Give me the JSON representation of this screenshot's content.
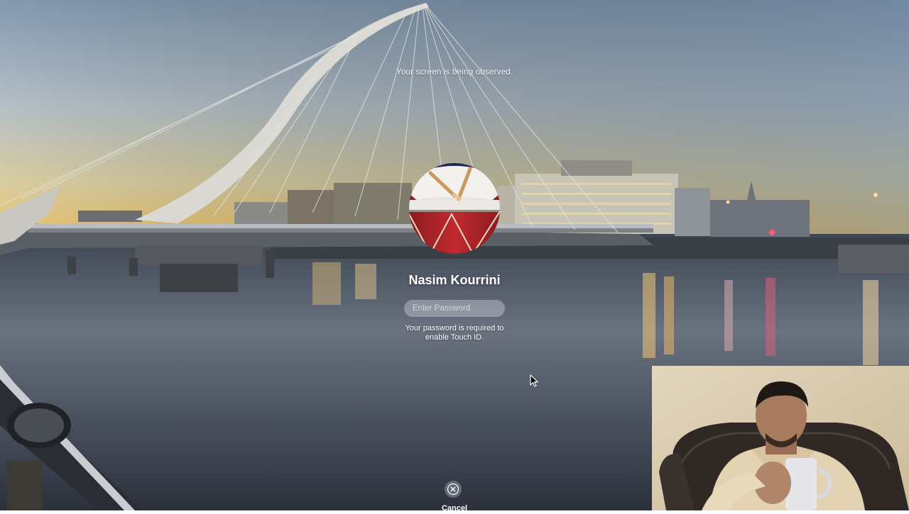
{
  "banner": {
    "text": "Your screen is being observed."
  },
  "login": {
    "user_name": "Nasim Kourrini",
    "password_placeholder": "Enter Password",
    "hint_line1": "Your password is required to",
    "hint_line2": "enable Touch ID.",
    "avatar_icon": "drum-avatar-icon"
  },
  "footer": {
    "cancel_label": "Cancel",
    "cancel_icon": "close-circle-icon"
  },
  "webcam": {
    "icon": "webcam-overlay"
  },
  "colors": {
    "sky_top": "#8aa0b6",
    "sky_horizon": "#e8c977",
    "water": "#5b6472",
    "drum_red": "#b12429",
    "drum_top": "#f2f0ee"
  }
}
